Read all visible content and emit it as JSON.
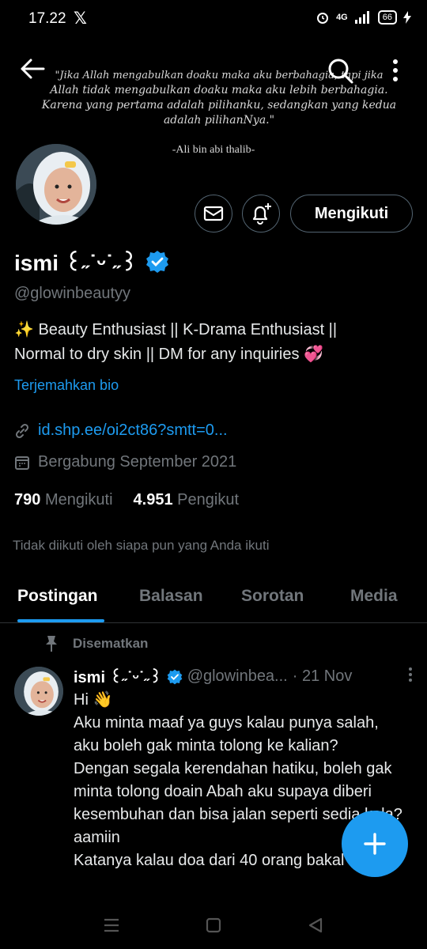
{
  "status_bar": {
    "time": "17.22",
    "app_logo": "𝕏",
    "network": "4G",
    "battery": "66"
  },
  "banner": {
    "quote_line1": "\"Jika Allah mengabulkan doaku maka aku berbahagia, tapi jika",
    "quote_line2": "Allah tidak mengabulkan doaku maka aku lebih berbahagia.",
    "quote_line3": "Karena yang pertama adalah pilihanku, sedangkan yang kedua",
    "quote_line4": "adalah pilihanNya.\"",
    "author": "-Ali bin abi thalib-"
  },
  "toolbar": {
    "back_icon": "arrow-left-icon",
    "search_icon": "search-icon",
    "more_icon": "more-vertical-icon"
  },
  "profile": {
    "follow_label": "Mengikuti",
    "name": "ismi ꒰ᐢ.ˬ.ᐢ꒱ ᝰ",
    "name_display": "ismi ꒰˶˙ᵕ˙˶꒱ ",
    "handle": "@glowinbeautyy",
    "bio_line1": "✨ Beauty Enthusiast || K-Drama Enthusiast ||",
    "bio_line2": "Normal to dry skin || DM for any inquiries 💞",
    "translate": "Terjemahkan bio",
    "link": "id.shp.ee/oi2ct86?smtt=0...",
    "joined": "Bergabung September 2021",
    "following_count": "790",
    "following_label": "Mengikuti",
    "followers_count": "4.951",
    "followers_label": "Pengikut",
    "not_followed": "Tidak diikuti oleh siapa pun yang Anda ikuti",
    "verified_color": "#1d9bf0"
  },
  "tabs": [
    {
      "label": "Postingan"
    },
    {
      "label": "Balasan"
    },
    {
      "label": "Sorotan"
    },
    {
      "label": "Media"
    }
  ],
  "pinned_post": {
    "pinned_label": "Disematkan",
    "name": "ismi ꒰˶˙ᵕ˙˶꒱ ",
    "handle": "@glowinbea...",
    "date": "· 21 Nov",
    "text": "Hi 👋\nAku minta maaf ya guys kalau punya salah, aku boleh gak minta tolong ke kalian?\nDengan segala kerendahan hatiku, boleh gak minta tolong doain Abah aku supaya diberi kesembuhan dan bisa jalan seperti sedia kala? aamiin\nKatanya kalau doa dari 40 orang bakal"
  },
  "accent_color": "#1d9bf0"
}
